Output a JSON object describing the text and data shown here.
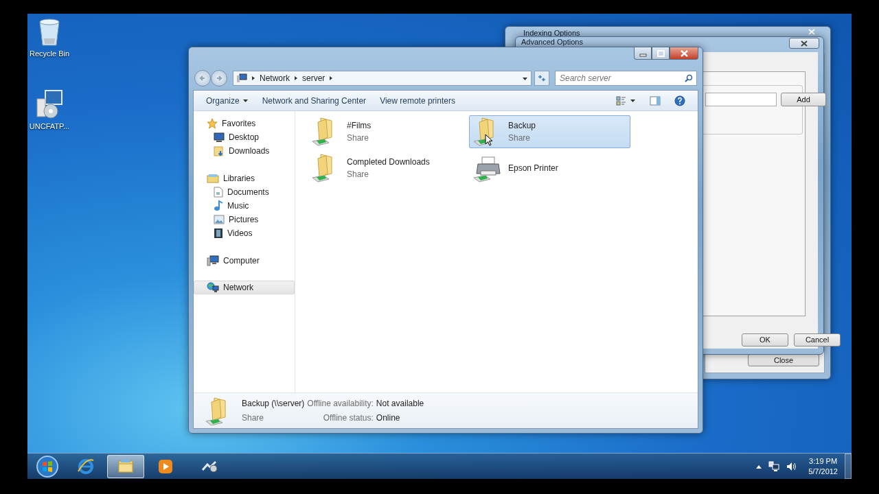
{
  "desktop_icons": [
    {
      "label": "Recycle Bin",
      "kind": "recycle"
    },
    {
      "label": "UNCFATP...",
      "kind": "installer"
    }
  ],
  "indexing_window": {
    "title": "Indexing Options",
    "close_button": "Close"
  },
  "advanced_dialog": {
    "title": "Advanced Options",
    "add_button": "Add",
    "buttons": [
      "OK",
      "Cancel"
    ]
  },
  "explorer": {
    "breadcrumb": [
      "Network",
      "server"
    ],
    "search": {
      "placeholder": "Search server"
    },
    "toolbar": [
      {
        "label": "Organize",
        "dropdown": true
      },
      {
        "label": "Network and Sharing Center",
        "dropdown": false
      },
      {
        "label": "View remote printers",
        "dropdown": false
      }
    ],
    "nav": [
      {
        "label": "Favorites",
        "kind": "star",
        "selected": false,
        "children": [
          {
            "label": "Desktop",
            "kind": "desktop",
            "selected": false
          },
          {
            "label": "Downloads",
            "kind": "downloads",
            "selected": false
          }
        ]
      },
      {
        "label": "Libraries",
        "kind": "library",
        "selected": false,
        "children": [
          {
            "label": "Documents",
            "kind": "document",
            "selected": false
          },
          {
            "label": "Music",
            "kind": "music",
            "selected": false
          },
          {
            "label": "Pictures",
            "kind": "pictures",
            "selected": false
          },
          {
            "label": "Videos",
            "kind": "videos",
            "selected": false
          }
        ]
      },
      {
        "label": "Computer",
        "kind": "computer",
        "selected": false
      },
      {
        "label": "Network",
        "kind": "network",
        "selected": true
      }
    ],
    "items": [
      {
        "name": "#Films",
        "subtitle": "Share",
        "kind": "share",
        "selected": false
      },
      {
        "name": "Backup",
        "subtitle": "Share",
        "kind": "share",
        "selected": true
      },
      {
        "name": "Completed Downloads",
        "subtitle": "Share",
        "kind": "share",
        "selected": false
      },
      {
        "name": "Epson Printer",
        "kind": "printer",
        "selected": false
      }
    ],
    "details": {
      "name": "Backup (\\\\server)",
      "type": "Share",
      "fields": [
        {
          "label": "Offline availability:",
          "value": "Not available"
        },
        {
          "label": "Offline status:",
          "value": "Online"
        }
      ]
    }
  },
  "taskbar": {
    "buttons": [
      {
        "kind": "ie",
        "active": false
      },
      {
        "kind": "explorer",
        "active": true
      },
      {
        "kind": "media",
        "active": false
      },
      {
        "kind": "tool",
        "active": false
      }
    ],
    "time": "3:19 PM",
    "date": "5/7/2012"
  }
}
